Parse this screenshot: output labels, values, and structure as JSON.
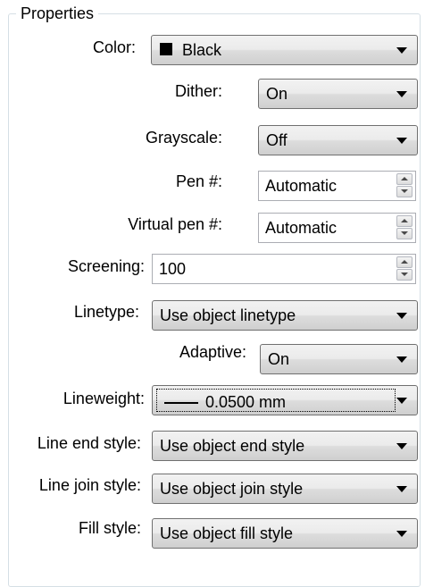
{
  "group": {
    "title": "Properties"
  },
  "fields": {
    "color": {
      "label": "Color:",
      "value": "Black",
      "swatch": "#000000"
    },
    "dither": {
      "label": "Dither:",
      "value": "On"
    },
    "grayscale": {
      "label": "Grayscale:",
      "value": "Off"
    },
    "pen": {
      "label": "Pen #:",
      "value": "Automatic"
    },
    "virtual_pen": {
      "label": "Virtual pen #:",
      "value": "Automatic"
    },
    "screening": {
      "label": "Screening:",
      "value": "100"
    },
    "linetype": {
      "label": "Linetype:",
      "value": "Use object linetype"
    },
    "adaptive": {
      "label": "Adaptive:",
      "value": "On"
    },
    "lineweight": {
      "label": "Lineweight:",
      "value": "0.0500 mm"
    },
    "line_end": {
      "label": "Line end style:",
      "value": "Use object end style"
    },
    "line_join": {
      "label": "Line join style:",
      "value": "Use object join style"
    },
    "fill": {
      "label": "Fill style:",
      "value": "Use object fill style"
    }
  },
  "icons": {
    "dropdown": "chevron-down-icon",
    "spin_up": "spin-up-icon",
    "spin_down": "spin-down-icon"
  }
}
